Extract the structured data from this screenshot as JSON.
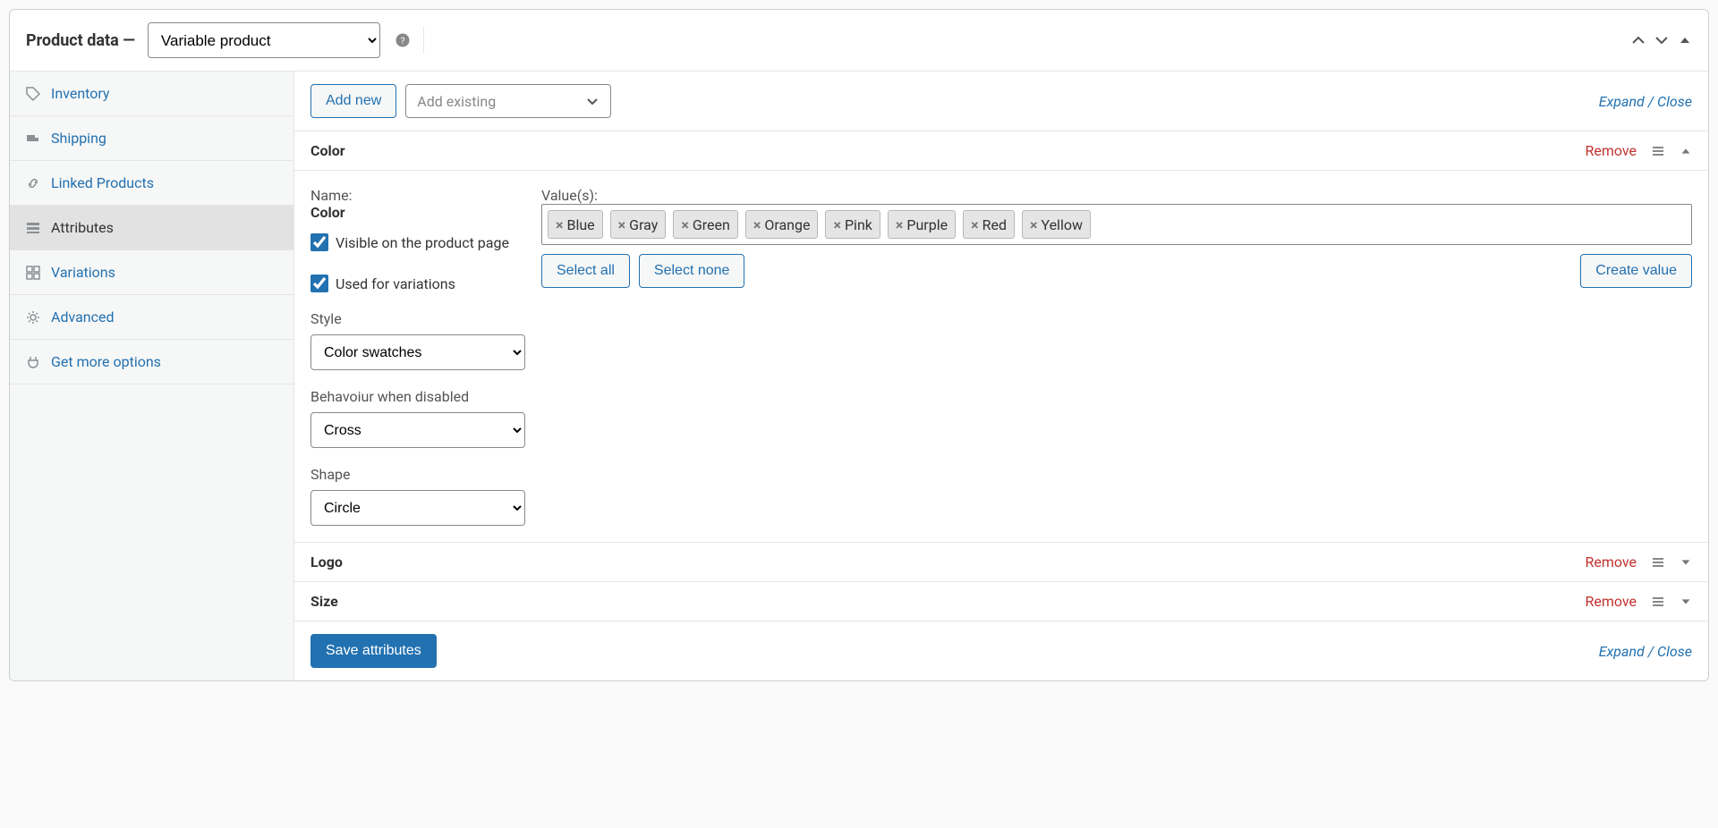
{
  "header": {
    "title_prefix": "Product data —",
    "product_type": "Variable product"
  },
  "sidebar": {
    "items": [
      {
        "label": "Inventory"
      },
      {
        "label": "Shipping"
      },
      {
        "label": "Linked Products"
      },
      {
        "label": "Attributes"
      },
      {
        "label": "Variations"
      },
      {
        "label": "Advanced"
      },
      {
        "label": "Get more options"
      }
    ]
  },
  "toolbar": {
    "add_new": "Add new",
    "add_existing_placeholder": "Add existing",
    "expand_close": "Expand / Close"
  },
  "attributes": {
    "color": {
      "title": "Color",
      "remove": "Remove",
      "name_label": "Name:",
      "name_value": "Color",
      "values_label": "Value(s):",
      "tags": [
        "Blue",
        "Gray",
        "Green",
        "Orange",
        "Pink",
        "Purple",
        "Red",
        "Yellow"
      ],
      "visible_label": "Visible on the product page",
      "variations_label": "Used for variations",
      "select_all": "Select all",
      "select_none": "Select none",
      "create_value": "Create value",
      "style_label": "Style",
      "style_value": "Color swatches",
      "behaviour_label": "Behavoiur when disabled",
      "behaviour_value": "Cross",
      "shape_label": "Shape",
      "shape_value": "Circle"
    },
    "logo": {
      "title": "Logo",
      "remove": "Remove"
    },
    "size": {
      "title": "Size",
      "remove": "Remove"
    }
  },
  "footer": {
    "save_attributes": "Save attributes",
    "expand_close": "Expand / Close"
  }
}
